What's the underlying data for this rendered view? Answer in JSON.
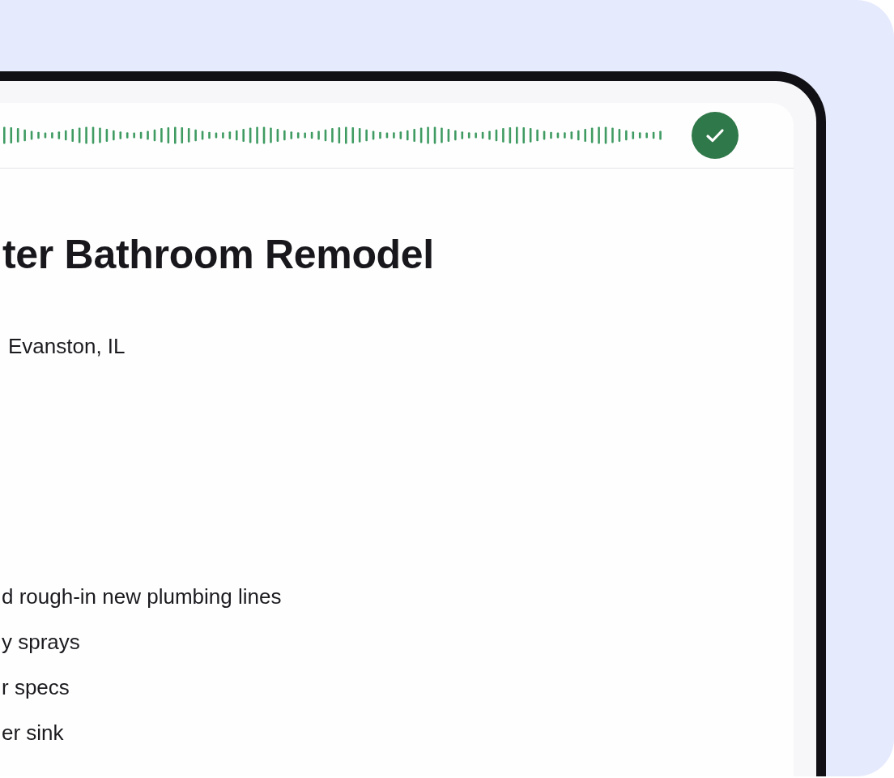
{
  "project": {
    "title": "ter Bathroom Remodel",
    "location": "Evanston, IL"
  },
  "scope_items": [
    "d rough-in new plumbing lines",
    "y sprays",
    "r specs",
    "er sink"
  ]
}
